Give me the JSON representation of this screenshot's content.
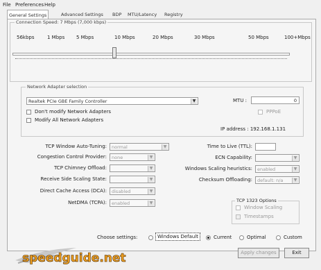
{
  "menu": {
    "file": "File",
    "preferences": "Preferences",
    "help": "Help"
  },
  "tabs": [
    "General Settings",
    "Advanced Settings",
    "BDP",
    "MTU/Latency",
    "Registry"
  ],
  "connection": {
    "legend": "Connection Speed: 7 Mbps (7,000 kbps)",
    "labels": [
      "56kbps",
      "1 Mbps",
      "5 Mbps",
      "10 Mbps",
      "20 Mbps",
      "30 Mbps",
      "50 Mbps",
      "100+Mbps"
    ],
    "slider_fraction": 0.36
  },
  "adapter": {
    "legend": "Network Adapter selection",
    "selected": "Realtek PCIe GBE Family Controller",
    "dont_modify": "Don't modify Network Adapters",
    "modify_all": "Modify All Network Adapters",
    "mtu_label": "MTU :",
    "mtu_value": "0",
    "pppoe": "PPPoE",
    "ip": "IP address : 192.168.1.131"
  },
  "left_settings": [
    {
      "label": "TCP Window Auto-Tuning:",
      "value": "normal"
    },
    {
      "label": "Congestion Control Provider:",
      "value": "none"
    },
    {
      "label": "TCP Chimney Offload:",
      "value": ""
    },
    {
      "label": "Receive Side Scaling State:",
      "value": ""
    },
    {
      "label": "Direct Cache Access (DCA):",
      "value": "disabled"
    },
    {
      "label": "NetDMA (TCPA):",
      "value": "enabled"
    }
  ],
  "right_settings": [
    {
      "label": "Time to Live (TTL):",
      "value": ""
    },
    {
      "label": "ECN Capability:",
      "value": ""
    },
    {
      "label": "Windows Scaling heuristics:",
      "value": "enabled"
    },
    {
      "label": "Checksum Offloading:",
      "value": "default: n/a"
    }
  ],
  "tcp1323": {
    "legend": "TCP 1323 Options",
    "window_scaling": "Window Scaling",
    "timestamps": "Timestamps"
  },
  "choose": {
    "label": "Choose settings:",
    "options": [
      "Windows Default",
      "Current",
      "Optimal",
      "Custom"
    ],
    "selected": "Current"
  },
  "buttons": {
    "apply": "Apply changes",
    "exit": "Exit"
  },
  "logo_text": "speedguide.net"
}
